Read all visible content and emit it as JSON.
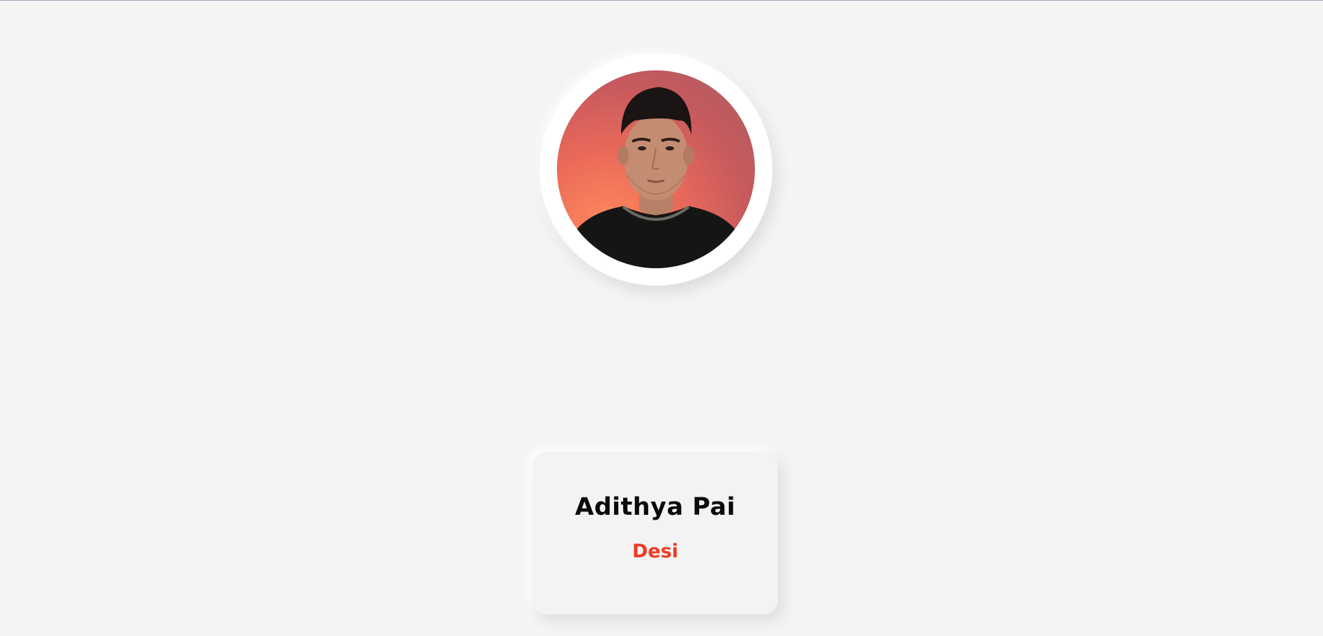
{
  "profile": {
    "name": "Adithya Pai",
    "role": "Desi",
    "avatar_icon": "user-portrait"
  },
  "colors": {
    "background": "#f4f4f4",
    "name_text": "#0a0a0a",
    "role_text": "#ef3b24",
    "avatar_ring": "#ffffff"
  }
}
